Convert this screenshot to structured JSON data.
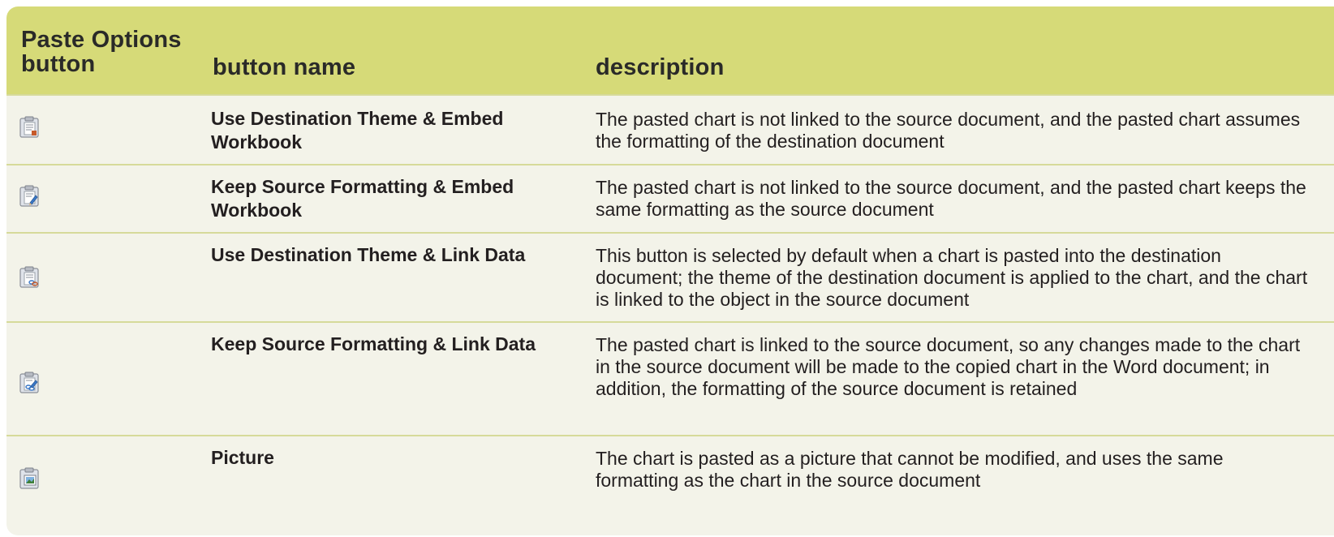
{
  "table": {
    "header": {
      "col1": "Paste Options button",
      "col2": "button name",
      "col3": "description"
    },
    "rows": [
      {
        "icon": "paste-destination-theme-embed-icon",
        "name": "Use Destination Theme & Embed Workbook",
        "description": "The pasted chart is not linked to the source document, and the pasted chart assumes the formatting of the destination document"
      },
      {
        "icon": "paste-keep-source-embed-icon",
        "name": "Keep Source Formatting & Embed Workbook",
        "description": "The pasted chart is not linked to the source document, and the pasted chart keeps the same formatting as the source document"
      },
      {
        "icon": "paste-destination-theme-link-icon",
        "name": "Use Destination Theme & Link Data",
        "description": "This button is selected by default when a chart is pasted into the destination document; the theme of the destination document is applied to the chart, and the chart is linked to the object in the source document"
      },
      {
        "icon": "paste-keep-source-link-icon",
        "name": "Keep Source Formatting & Link Data",
        "description": "The pasted chart is linked to the source document, so any changes made to the chart in the source document will be made to the copied chart in the Word document; in addition, the formatting of the source document is retained"
      },
      {
        "icon": "paste-picture-icon",
        "name": "Picture",
        "description": "The chart is pasted as a picture that cannot be modified, and uses the same formatting as the chart in the source document"
      }
    ]
  },
  "colors": {
    "header_bg": "#d6da78",
    "body_bg": "#f3f3e9",
    "row_divider": "#d6da9a"
  }
}
